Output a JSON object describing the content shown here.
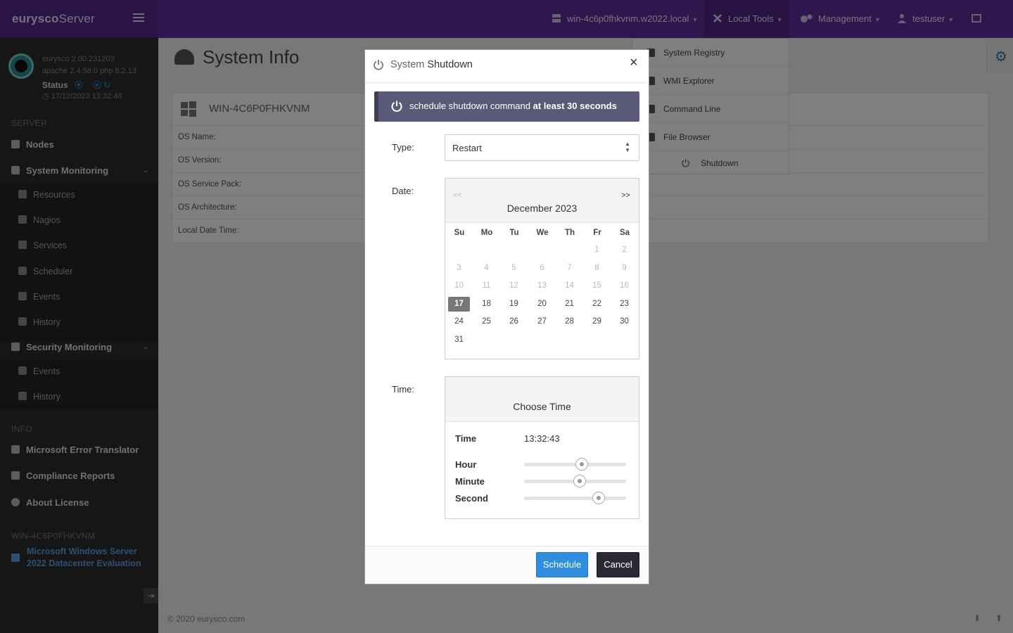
{
  "brand": {
    "part1": "eurysco",
    "part2": "Server"
  },
  "topnav": {
    "host": "win-4c6p0fhkvnm.w2022.local",
    "local_tools": "Local Tools",
    "management": "Management",
    "user": "testuser"
  },
  "sidebar": {
    "version": "eurysco 2.00.231203",
    "stack": "apache 2.4.58.0  php 8.2.13",
    "status_label": "Status",
    "datetime": "17/12/2023 13:32:48",
    "server_head": "SERVER",
    "nodes": "Nodes",
    "system_monitoring": "System Monitoring",
    "sm_items": [
      "Resources",
      "Nagios",
      "Services",
      "Scheduler",
      "Events",
      "History"
    ],
    "security_monitoring": "Security Monitoring",
    "sec_items": [
      "Events",
      "History"
    ],
    "info_head": "INFO",
    "error_translator": "Microsoft Error Translator",
    "compliance": "Compliance Reports",
    "license": "About License",
    "host_head": "WIN-4C6P0FHKVNM",
    "os_line1": "Microsoft  Windows  Server",
    "os_line2": "2022  Datacenter  Evaluation"
  },
  "page": {
    "title": "System Info",
    "card_title": "WIN-4C6P0FHKVNM",
    "rows": [
      "OS Name:",
      "OS Version:",
      "OS Service Pack:",
      "OS Architecture:",
      "Local Date Time:"
    ],
    "footer": "© 2020   eurysco.com"
  },
  "dropdown": {
    "items": [
      "System Registry",
      "WMI Explorer",
      "Command Line",
      "File Browser"
    ],
    "shutdown": "Shutdown"
  },
  "modal": {
    "title_a": "System",
    "title_b": "Shutdown",
    "close": "×",
    "alert_a": "schedule shutdown command",
    "alert_b": "at least 30 seconds",
    "type_label": "Type:",
    "type_value": "Restart",
    "date_label": "Date:",
    "time_label": "Time:",
    "calendar": {
      "prev": "<<",
      "next": ">>",
      "month": "December 2023",
      "dow": [
        "Su",
        "Mo",
        "Tu",
        "We",
        "Th",
        "Fr",
        "Sa"
      ],
      "weeks": [
        [
          "",
          "",
          "",
          "",
          "",
          "1",
          "2"
        ],
        [
          "3",
          "4",
          "5",
          "6",
          "7",
          "8",
          "9"
        ],
        [
          "10",
          "11",
          "12",
          "13",
          "14",
          "15",
          "16"
        ],
        [
          "17",
          "18",
          "19",
          "20",
          "21",
          "22",
          "23"
        ],
        [
          "24",
          "25",
          "26",
          "27",
          "28",
          "29",
          "30"
        ],
        [
          "31",
          "",
          "",
          "",
          "",
          "",
          ""
        ]
      ],
      "selected": "17",
      "first_enabled": 17
    },
    "timepicker": {
      "title": "Choose Time",
      "time_label": "Time",
      "time_value": "13:32:43",
      "hour_label": "Hour",
      "minute_label": "Minute",
      "second_label": "Second",
      "hour": 13,
      "minute": 32,
      "second": 43
    },
    "schedule": "Schedule",
    "cancel": "Cancel"
  },
  "colors": {
    "topbar": "#5e2f9a",
    "alert": "#5a5a78",
    "primary": "#2f8fde",
    "dark": "#2a2a36"
  }
}
